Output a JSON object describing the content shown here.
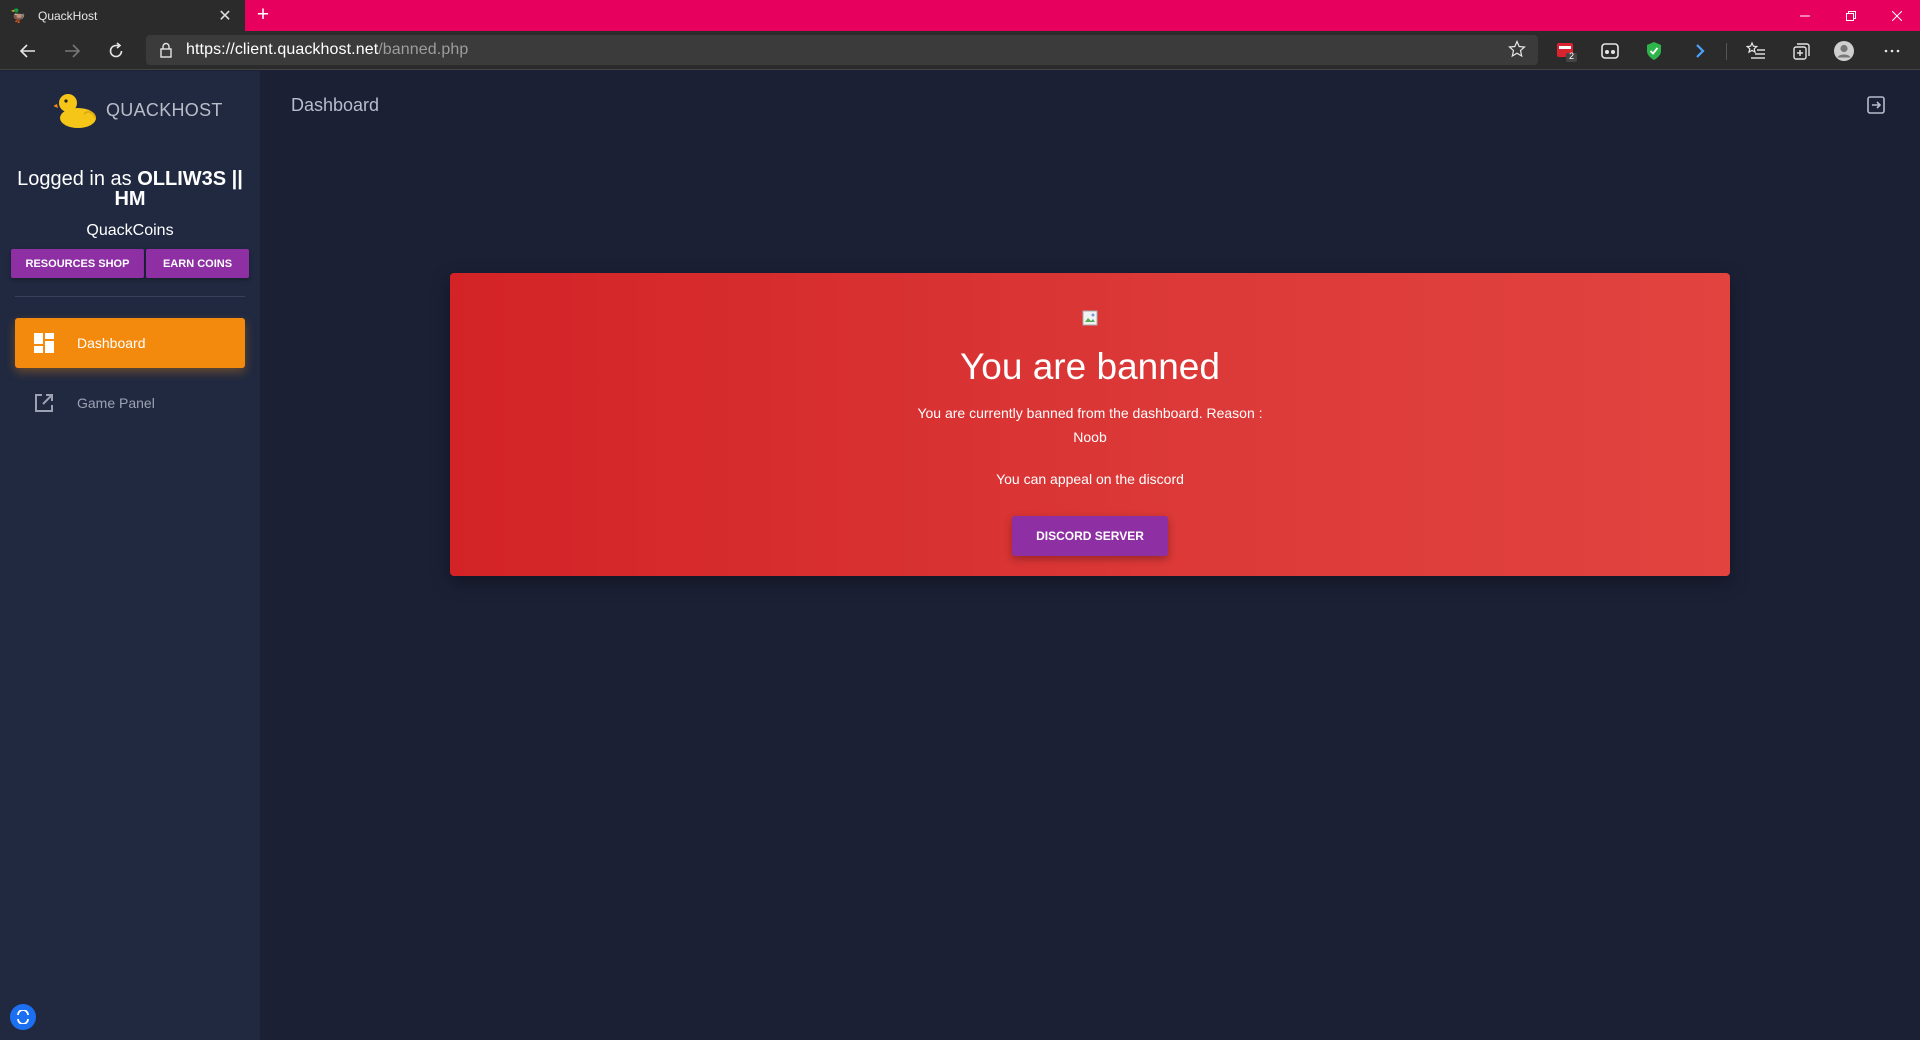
{
  "browser": {
    "tab_title": "QuackHost",
    "tab_favicon": "🦆",
    "url_host": "https://client.quackhost.net",
    "url_path": "/banned.php",
    "extension_badge": "2"
  },
  "sidebar": {
    "brand": "QUACKHOST",
    "logged_in_prefix": "Logged in as ",
    "username": "OLLIW3S || HM",
    "coins_label": "QuackCoins",
    "buttons": [
      "RESOURCES SHOP",
      "EARN COINS"
    ],
    "nav": [
      {
        "label": "Dashboard",
        "icon": "dashboard-icon",
        "active": true
      },
      {
        "label": "Game Panel",
        "icon": "external-link-icon",
        "active": false
      }
    ]
  },
  "header": {
    "title": "Dashboard"
  },
  "ban": {
    "title": "You are banned",
    "reason_line": "You are currently banned from the dashboard. Reason :",
    "reason": "Noob",
    "appeal": "You can appeal on the discord",
    "button": "DISCORD SERVER"
  },
  "colors": {
    "titlebar": "#e8005f",
    "sidebar": "#202940",
    "main_bg": "#1b2035",
    "active_nav": "#f38a0e",
    "purple_button": "#8e30a4",
    "ban_card": "#d32327"
  }
}
